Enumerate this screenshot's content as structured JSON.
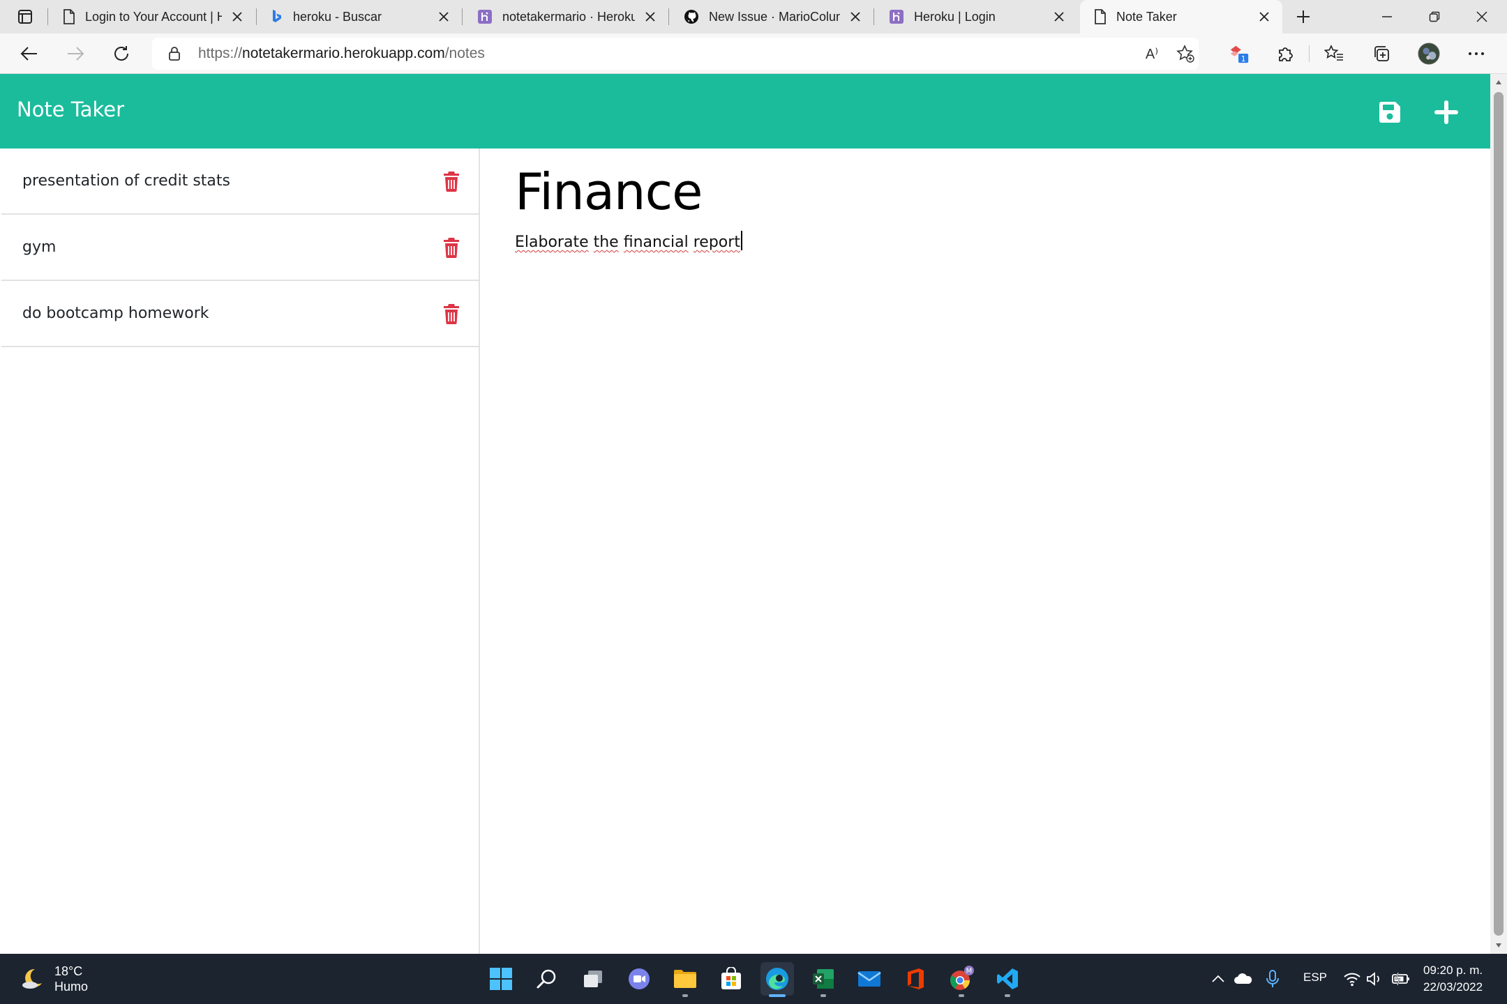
{
  "browser": {
    "tabs": [
      {
        "title": "Login to Your Account | H",
        "icon": "page-icon"
      },
      {
        "title": "heroku - Buscar",
        "icon": "bing-icon"
      },
      {
        "title": "notetakermario · Heroku",
        "icon": "heroku-icon"
      },
      {
        "title": "New Issue · MarioColung",
        "icon": "github-icon"
      },
      {
        "title": "Heroku | Login",
        "icon": "heroku-icon"
      },
      {
        "title": "Note Taker",
        "icon": "page-icon",
        "active": true
      }
    ],
    "url_prefix": "https://",
    "url_host": "notetakermario.herokuapp.com",
    "url_path": "/notes",
    "read_aloud_label": "A⁾",
    "extension_badge": "1"
  },
  "app": {
    "brand": "Note Taker",
    "accent_color": "#1abc9c",
    "delete_color": "#dc3545"
  },
  "notes": [
    {
      "title": "presentation of credit stats"
    },
    {
      "title": "gym"
    },
    {
      "title": "do bootcamp homework"
    }
  ],
  "active_note": {
    "title": "Finance",
    "body_words": [
      "Elaborate",
      "the",
      "financial",
      "report"
    ]
  },
  "taskbar": {
    "temperature": "18°C",
    "condition": "Humo",
    "language": "ESP",
    "time": "09:20 p. m.",
    "date": "22/03/2022",
    "chrome_badge": "M"
  }
}
